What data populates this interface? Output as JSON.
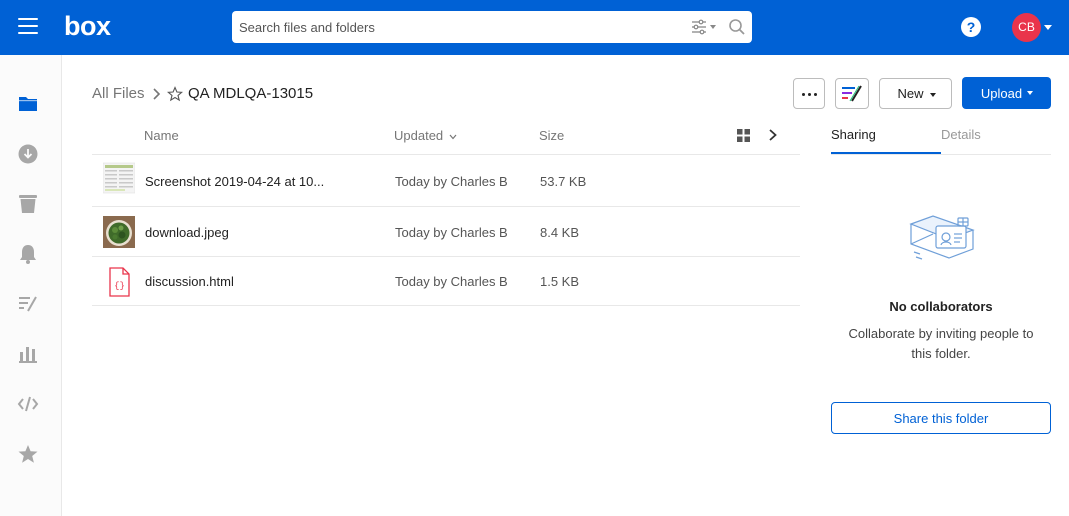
{
  "header": {
    "logo": "box",
    "search_placeholder": "Search files and folders",
    "help": "?",
    "avatar_initials": "CB"
  },
  "breadcrumb": {
    "root": "All Files",
    "current": "QA MDLQA-13015"
  },
  "toolbar": {
    "new_label": "New",
    "upload_label": "Upload"
  },
  "columns": {
    "name": "Name",
    "updated": "Updated",
    "size": "Size"
  },
  "files": [
    {
      "name": "Screenshot 2019-04-24 at 10...",
      "updated": "Today by Charles B",
      "size": "53.7 KB",
      "type": "image-screenshot"
    },
    {
      "name": "download.jpeg",
      "updated": "Today by Charles B",
      "size": "8.4 KB",
      "type": "image-photo"
    },
    {
      "name": "discussion.html",
      "updated": "Today by Charles B",
      "size": "1.5 KB",
      "type": "code-file"
    }
  ],
  "sidebar": {
    "tabs": [
      {
        "label": "Sharing",
        "active": true
      },
      {
        "label": "Details",
        "active": false
      }
    ],
    "empty_title": "No collaborators",
    "empty_description": "Collaborate by inviting people to this folder.",
    "share_button": "Share this folder"
  },
  "nav_icons": [
    "folder-icon",
    "download-icon",
    "trash-icon",
    "bell-icon",
    "notes-icon",
    "analytics-icon",
    "code-icon",
    "star-icon"
  ],
  "colors": {
    "brand": "#0061d5",
    "avatar": "#e9344b",
    "nav_icon": "#a7a7a7"
  }
}
